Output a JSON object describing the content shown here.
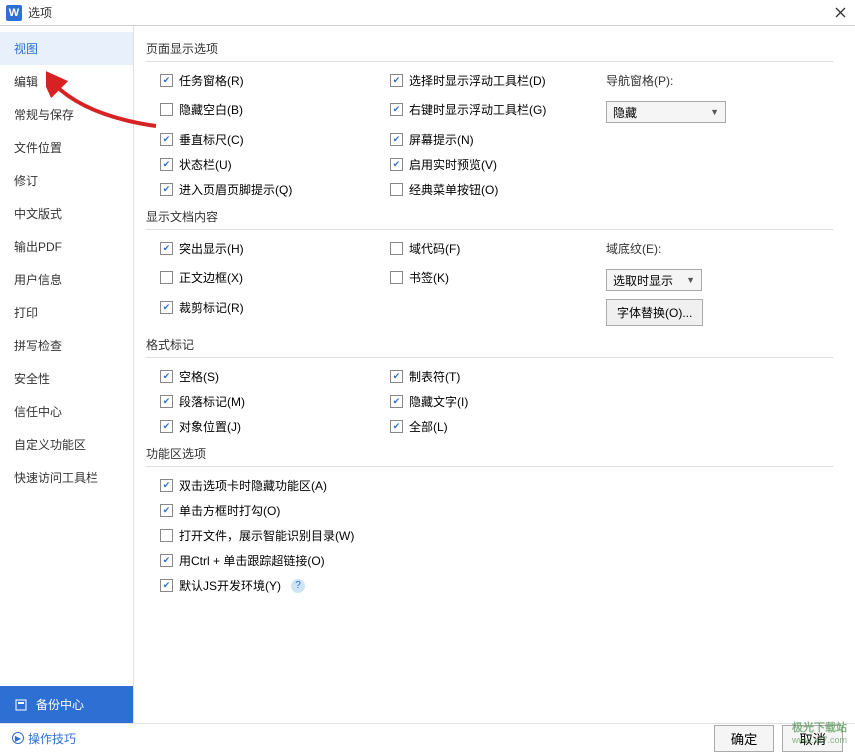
{
  "titlebar": {
    "title": "选项"
  },
  "sidebar": {
    "items": [
      {
        "label": "视图",
        "active": true
      },
      {
        "label": "编辑"
      },
      {
        "label": "常规与保存"
      },
      {
        "label": "文件位置"
      },
      {
        "label": "修订"
      },
      {
        "label": "中文版式"
      },
      {
        "label": "输出PDF"
      },
      {
        "label": "用户信息"
      },
      {
        "label": "打印"
      },
      {
        "label": "拼写检查"
      },
      {
        "label": "安全性"
      },
      {
        "label": "信任中心"
      },
      {
        "label": "自定义功能区"
      },
      {
        "label": "快速访问工具栏"
      }
    ],
    "backup": "备份中心"
  },
  "sections": {
    "pageDisplay": {
      "title": "页面显示选项",
      "col1": [
        {
          "label": "任务窗格(R)",
          "checked": true
        },
        {
          "label": "隐藏空白(B)",
          "checked": false
        },
        {
          "label": "垂直标尺(C)",
          "checked": true
        },
        {
          "label": "状态栏(U)",
          "checked": true
        },
        {
          "label": "进入页眉页脚提示(Q)",
          "checked": true
        }
      ],
      "col2": [
        {
          "label": "选择时显示浮动工具栏(D)",
          "checked": true
        },
        {
          "label": "右键时显示浮动工具栏(G)",
          "checked": true
        },
        {
          "label": "屏幕提示(N)",
          "checked": true
        },
        {
          "label": "启用实时预览(V)",
          "checked": true
        },
        {
          "label": "经典菜单按钮(O)",
          "checked": false
        }
      ],
      "navLabel": "导航窗格(P):",
      "navValue": "隐藏"
    },
    "docContent": {
      "title": "显示文档内容",
      "col1": [
        {
          "label": "突出显示(H)",
          "checked": true
        },
        {
          "label": "正文边框(X)",
          "checked": false
        },
        {
          "label": "裁剪标记(R)",
          "checked": true
        }
      ],
      "col2": [
        {
          "label": "域代码(F)",
          "checked": false
        },
        {
          "label": "书签(K)",
          "checked": false
        }
      ],
      "shadingLabel": "域底纹(E):",
      "shadingValue": "选取时显示",
      "fontSubBtn": "字体替换(O)..."
    },
    "format": {
      "title": "格式标记",
      "col1": [
        {
          "label": "空格(S)",
          "checked": true
        },
        {
          "label": "段落标记(M)",
          "checked": true
        },
        {
          "label": "对象位置(J)",
          "checked": true
        }
      ],
      "col2": [
        {
          "label": "制表符(T)",
          "checked": true
        },
        {
          "label": "隐藏文字(I)",
          "checked": true
        },
        {
          "label": "全部(L)",
          "checked": true
        }
      ]
    },
    "ribbon": {
      "title": "功能区选项",
      "items": [
        {
          "label": "双击选项卡时隐藏功能区(A)",
          "checked": true
        },
        {
          "label": "单击方框时打勾(O)",
          "checked": true
        },
        {
          "label": "打开文件，展示智能识别目录(W)",
          "checked": false
        },
        {
          "label": "用Ctrl + 单击跟踪超链接(O)",
          "checked": true
        },
        {
          "label": "默认JS开发环境(Y)",
          "checked": true,
          "help": true
        }
      ]
    }
  },
  "footer": {
    "tips": "操作技巧",
    "ok": "确定",
    "cancel": "取消"
  },
  "watermark": {
    "line1": "极光下载站",
    "line2": "www.xz7.com"
  }
}
